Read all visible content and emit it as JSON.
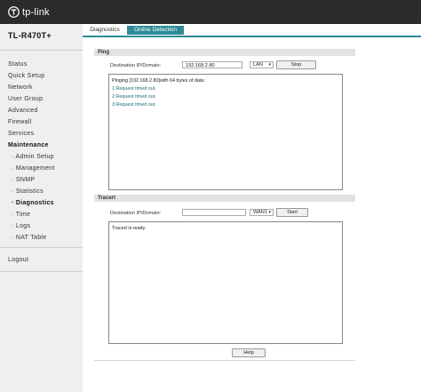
{
  "brand": {
    "logo_text": "tp-link"
  },
  "sidebar": {
    "model": "TL-R470T+",
    "items": [
      {
        "label": "Status"
      },
      {
        "label": "Quick Setup"
      },
      {
        "label": "Network"
      },
      {
        "label": "User Group"
      },
      {
        "label": "Advanced"
      },
      {
        "label": "Firewall"
      },
      {
        "label": "Services"
      },
      {
        "label": "Maintenance"
      },
      {
        "label": "· Admin Setup"
      },
      {
        "label": "· Management"
      },
      {
        "label": "· SNMP"
      },
      {
        "label": "· Statistics"
      },
      {
        "label": "· Diagnostics"
      },
      {
        "label": "· Time"
      },
      {
        "label": "· Logs"
      },
      {
        "label": "· NAT Table"
      },
      {
        "label": "Logout"
      }
    ]
  },
  "tabs": [
    {
      "label": "Diagnostics"
    },
    {
      "label": "Online Detection"
    }
  ],
  "ping": {
    "title": "Ping",
    "dest_label": "Destination IP/Domain:",
    "dest_value": "192.168.2.80",
    "interface": "LAN",
    "button": "Stop",
    "output": [
      "Pinging [192.168.2.80]with 64 bytes of data:",
      "1:Request timed out.",
      "2:Request timed out.",
      "3:Request timed out."
    ]
  },
  "tracert": {
    "title": "Tracert",
    "dest_label": "Destination IP/Domain:",
    "dest_value": "",
    "interface": "WAN1",
    "button": "Start",
    "output": [
      "Tracert is ready."
    ]
  },
  "help_button": "Help",
  "colors": {
    "topbar": "#2b2b2b",
    "accent": "#2e8b97",
    "sidebar": "#efefef"
  }
}
